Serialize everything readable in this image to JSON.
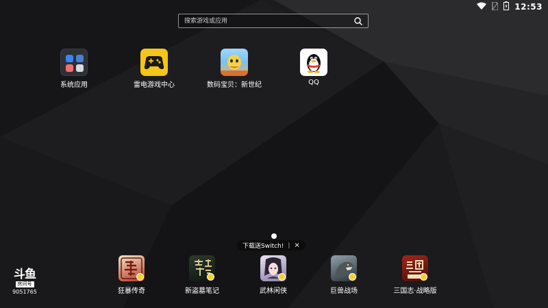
{
  "status_bar": {
    "time": "12:53"
  },
  "search": {
    "placeholder": "搜索游戏或应用"
  },
  "home_apps": [
    {
      "label": "系统应用",
      "icon": "system-apps-folder-icon"
    },
    {
      "label": "雷电游戏中心",
      "icon": "gamepad-icon",
      "color": "#f5c518"
    },
    {
      "label": "数码宝贝：新世纪",
      "icon": "digimon-icon"
    },
    {
      "label": "QQ",
      "icon": "qq-penguin-icon"
    }
  ],
  "promo": {
    "text": "下载送Switch!",
    "separator": "|",
    "close": "×"
  },
  "dock_apps": [
    {
      "label": "狂暴传奇",
      "icon": "kuangbao-chuanqi-icon"
    },
    {
      "label": "新盗墓笔记",
      "icon": "daomu-biji-icon"
    },
    {
      "label": "武林闲侠",
      "icon": "wulin-xianxia-icon"
    },
    {
      "label": "巨兽战场",
      "icon": "jushou-zhanchang-icon"
    },
    {
      "label": "三国志·战略版",
      "icon": "sanguozhi-icon"
    }
  ],
  "watermark": {
    "logo": "斗鱼",
    "room_label": "房间号",
    "room_number": "9051765"
  }
}
